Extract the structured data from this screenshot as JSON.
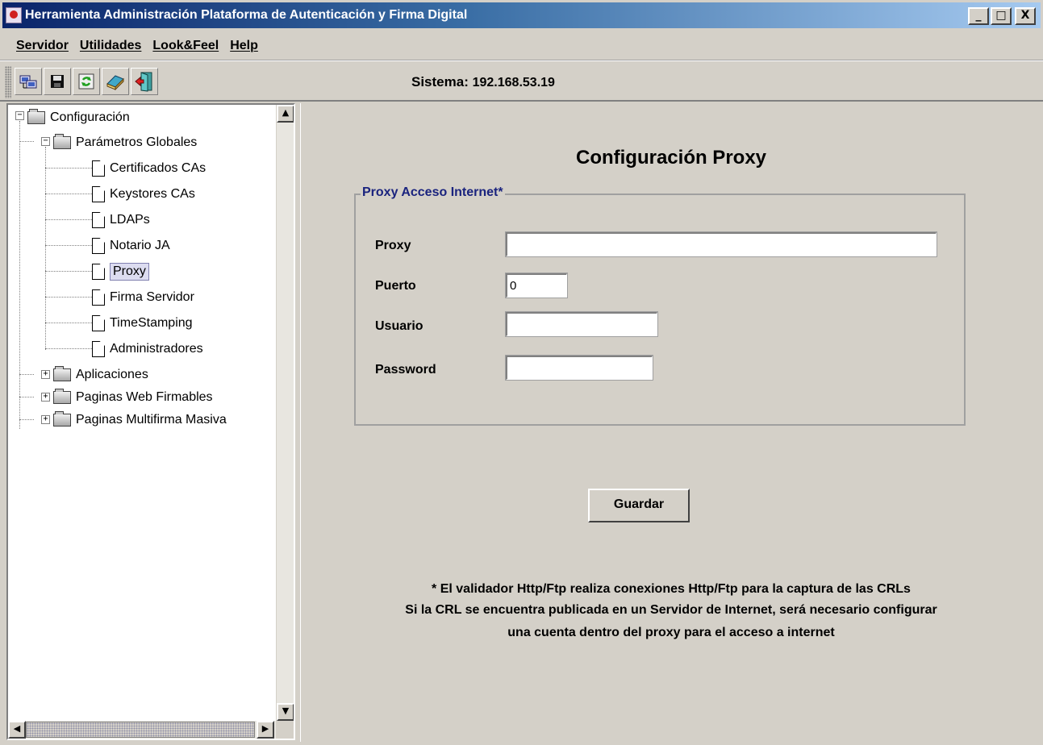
{
  "window": {
    "title": "Herramienta Administración Plataforma de Autenticación y Firma Digital",
    "minimize": "_",
    "maximize": "□",
    "close": "X"
  },
  "menu": {
    "items": [
      "Servidor",
      "Utilidades",
      "Look&Feel",
      "Help"
    ]
  },
  "toolbar": {
    "buttons": [
      "network-icon",
      "save-icon",
      "refresh-icon",
      "book-icon",
      "exit-door-icon"
    ],
    "system_label": "Sistema:",
    "system_ip": "192.168.53.19"
  },
  "tree": {
    "root": "Configuración",
    "global_params": "Parámetros Globales",
    "children": [
      "Certificados CAs",
      "Keystores CAs",
      "LDAPs",
      "Notario JA",
      "Proxy",
      "Firma Servidor",
      "TimeStamping",
      "Administradores"
    ],
    "selected": "Proxy",
    "collapsed": [
      "Aplicaciones",
      "Paginas Web Firmables",
      "Paginas Multifirma Masiva"
    ],
    "toggle_expanded": "−",
    "toggle_collapsed": "+"
  },
  "scroll": {
    "up": "▲",
    "down": "▼",
    "left": "◀",
    "right": "▶"
  },
  "content": {
    "title": "Configuración Proxy",
    "group_label": "Proxy Acceso Internet*",
    "fields": {
      "proxy_label": "Proxy",
      "proxy_value": "",
      "port_label": "Puerto",
      "port_value": "0",
      "user_label": "Usuario",
      "user_value": "",
      "password_label": "Password",
      "password_value": ""
    },
    "save_button": "Guardar",
    "note_lines": [
      "* El validador Http/Ftp realiza conexiones Http/Ftp para la captura de las CRLs",
      "Si la CRL se encuentra publicada en un Servidor de Internet, será necesario configurar",
      "una cuenta dentro del proxy para el acceso a internet"
    ]
  }
}
